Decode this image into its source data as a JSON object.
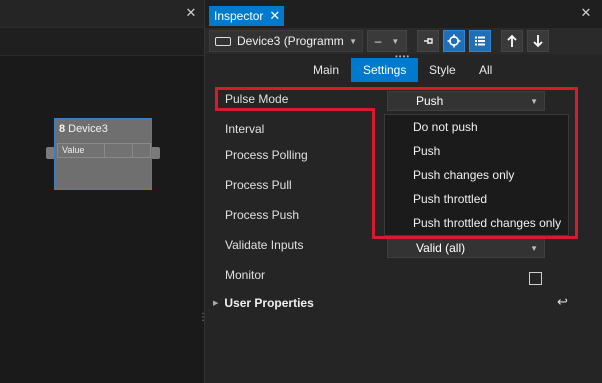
{
  "left_panel": {
    "close_glyph": "✕",
    "node": {
      "badge": "8",
      "title": "Device3",
      "row_label": "Value"
    }
  },
  "inspector": {
    "tab_title": "Inspector",
    "tab_close": "✕",
    "panel_close": "✕",
    "toolbar": {
      "device_name": "Device3 (Programm",
      "dash_label": "–",
      "buttons": [
        "pin-icon",
        "target-icon",
        "list-icon",
        "arrow-up-icon",
        "arrow-down-icon"
      ]
    },
    "category_tabs": [
      {
        "label": "Main",
        "active": false
      },
      {
        "label": "Settings",
        "active": true
      },
      {
        "label": "Style",
        "active": false
      },
      {
        "label": "All",
        "active": false
      }
    ],
    "properties": [
      {
        "label": "Pulse Mode",
        "value": "Push"
      },
      {
        "label": "Interval"
      },
      {
        "label": "Process Polling"
      },
      {
        "label": "Process Pull"
      },
      {
        "label": "Process Push"
      },
      {
        "label": "Validate Inputs",
        "value": "Valid (all)"
      },
      {
        "label": "Monitor"
      }
    ],
    "user_properties_label": "User Properties",
    "return_glyph": "↩",
    "dropdown_options": [
      "Do not push",
      "Push",
      "Push changes only",
      "Push throttled",
      "Push throttled changes only"
    ]
  },
  "colors": {
    "accent": "#007acc",
    "highlight": "#d41c2c",
    "node_border": "#3b7fc4"
  }
}
